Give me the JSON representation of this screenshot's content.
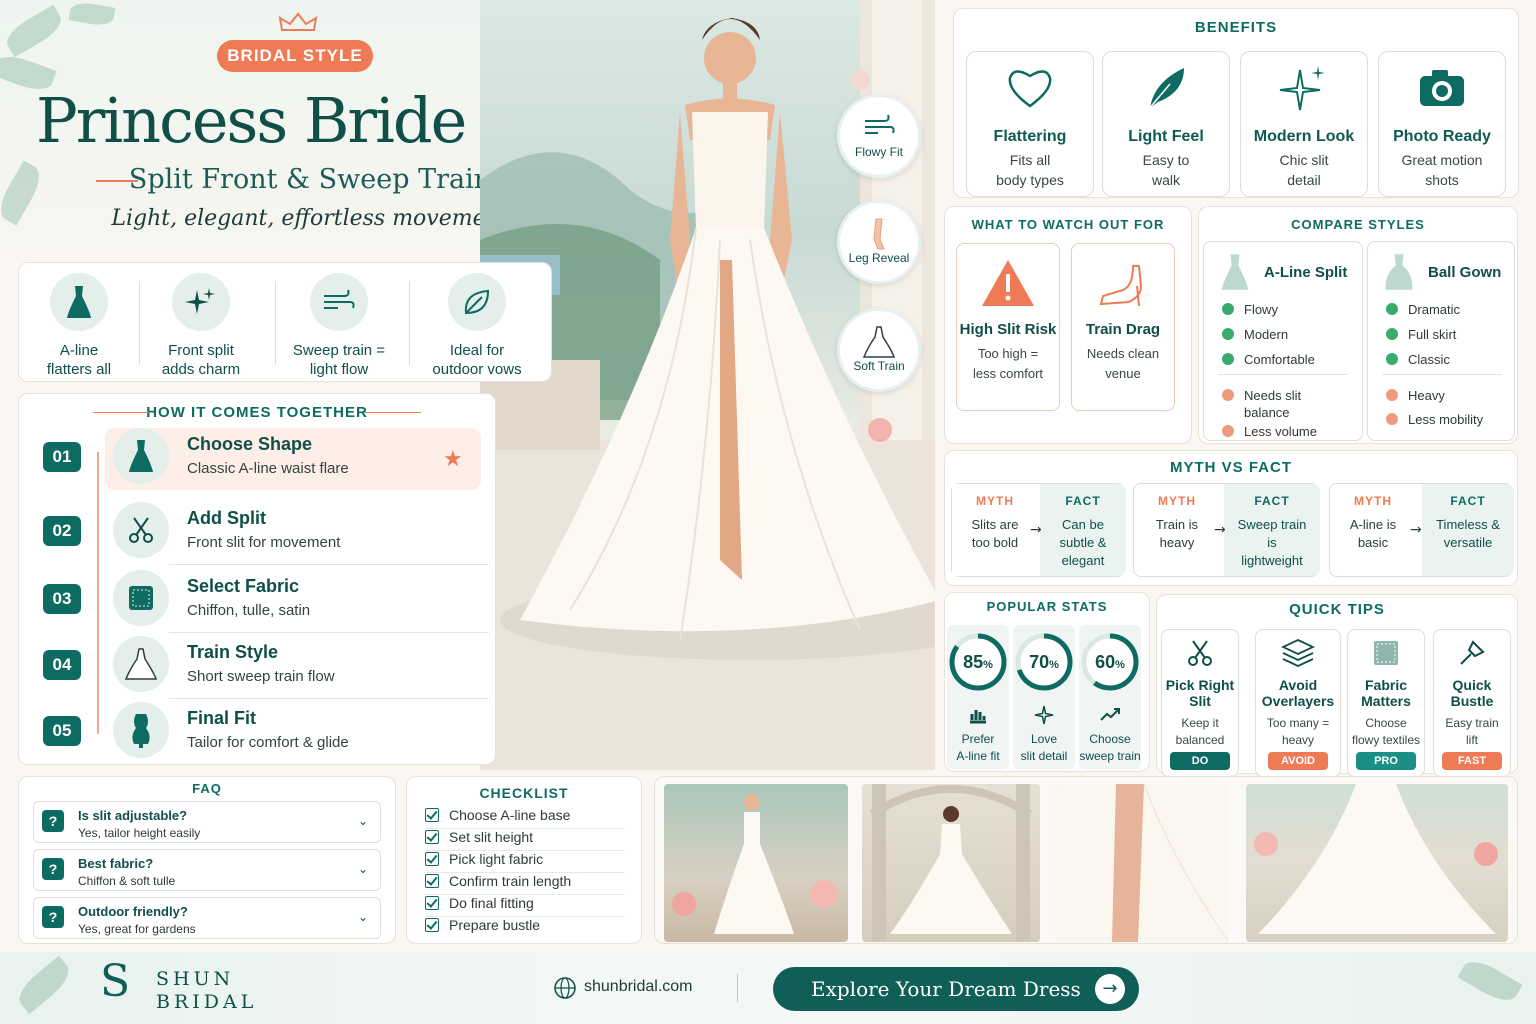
{
  "header": {
    "badge": "BRIDAL STYLE",
    "title": "Princess Bride A-Line",
    "subtitle": "Split Front & Sweep Train",
    "tagline": "Light, elegant, effortless movement"
  },
  "bubbles": [
    {
      "label": "Flowy Fit",
      "icon": "wind-icon"
    },
    {
      "label": "Leg Reveal",
      "icon": "leg-icon"
    },
    {
      "label": "Soft Train",
      "icon": "train-icon"
    }
  ],
  "features": [
    {
      "label1": "A-line",
      "label2": "flatters all",
      "icon": "dress-icon"
    },
    {
      "label1": "Front split",
      "label2": "adds charm",
      "icon": "sparkle-icon"
    },
    {
      "label1": "Sweep train =",
      "label2": "light flow",
      "icon": "wind-icon"
    },
    {
      "label1": "Ideal for",
      "label2": "outdoor vows",
      "icon": "leaf-icon"
    }
  ],
  "steps": {
    "title": "HOW IT COMES TOGETHER",
    "items": [
      {
        "num": "01",
        "title": "Choose Shape",
        "desc": "Classic A-line waist flare",
        "icon": "dress-icon"
      },
      {
        "num": "02",
        "title": "Add Split",
        "desc": "Front slit for movement",
        "icon": "scissors-icon"
      },
      {
        "num": "03",
        "title": "Select Fabric",
        "desc": "Chiffon, tulle, satin",
        "icon": "fabric-icon"
      },
      {
        "num": "04",
        "title": "Train Style",
        "desc": "Short sweep train flow",
        "icon": "train-icon"
      },
      {
        "num": "05",
        "title": "Final Fit",
        "desc": "Tailor for comfort & glide",
        "icon": "mannequin-icon"
      }
    ]
  },
  "benefits": {
    "title": "BENEFITS",
    "items": [
      {
        "title": "Flattering",
        "d1": "Fits all",
        "d2": "body types",
        "icon": "heart-icon"
      },
      {
        "title": "Light Feel",
        "d1": "Easy to",
        "d2": "walk",
        "icon": "feather-icon"
      },
      {
        "title": "Modern Look",
        "d1": "Chic slit",
        "d2": "detail",
        "icon": "sparkle-icon"
      },
      {
        "title": "Photo Ready",
        "d1": "Great motion",
        "d2": "shots",
        "icon": "camera-icon"
      }
    ]
  },
  "watch": {
    "title": "WHAT TO WATCH OUT FOR",
    "items": [
      {
        "title": "High Slit Risk",
        "d1": "Too high =",
        "d2": "less comfort",
        "icon": "warning-icon"
      },
      {
        "title": "Train Drag",
        "d1": "Needs clean",
        "d2": "venue",
        "icon": "heel-icon"
      }
    ]
  },
  "compare": {
    "title": "COMPARE STYLES",
    "a": {
      "name": "A-Line Split",
      "pros": [
        "Flowy",
        "Modern",
        "Comfortable"
      ],
      "cons": [
        "Needs slit",
        "balance",
        "Less volume"
      ]
    },
    "b": {
      "name": "Ball Gown",
      "pros": [
        "Dramatic",
        "Full skirt",
        "Classic"
      ],
      "cons": [
        "Heavy",
        "Less mobility"
      ]
    }
  },
  "myth": {
    "title": "MYTH VS FACT",
    "myth_label": "MYTH",
    "fact_label": "FACT",
    "pairs": [
      {
        "myth": [
          "Slits are",
          "too bold"
        ],
        "fact": [
          "Can be",
          "subtle &",
          "elegant"
        ]
      },
      {
        "myth": [
          "Train is",
          "heavy"
        ],
        "fact": [
          "Sweep train",
          "is",
          "lightweight"
        ]
      },
      {
        "myth": [
          "A-line is",
          "basic"
        ],
        "fact": [
          "Timeless &",
          "versatile"
        ]
      }
    ]
  },
  "stats": {
    "title": "POPULAR STATS",
    "items": [
      {
        "value": "85",
        "unit": "%",
        "pct": 85,
        "l1": "Prefer",
        "l2": "A-line fit",
        "icon": "bars-icon"
      },
      {
        "value": "70",
        "unit": "%",
        "pct": 70,
        "l1": "Love",
        "l2": "slit detail",
        "icon": "sparkle-icon"
      },
      {
        "value": "60",
        "unit": "%",
        "pct": 60,
        "l1": "Choose",
        "l2": "sweep train",
        "icon": "trend-icon"
      }
    ]
  },
  "tips": {
    "title": "QUICK TIPS",
    "items": [
      {
        "t1": "Pick Right",
        "t2": "Slit",
        "d1": "Keep it",
        "d2": "balanced",
        "badge": "DO",
        "color": "#0e6b62",
        "icon": "scissors-icon"
      },
      {
        "t1": "Avoid",
        "t2": "Overlayers",
        "d1": "Too many =",
        "d2": "heavy",
        "badge": "AVOID",
        "color": "#ef7a56",
        "icon": "layers-icon"
      },
      {
        "t1": "Fabric",
        "t2": "Matters",
        "d1": "Choose",
        "d2": "flowy textiles",
        "badge": "PRO",
        "color": "#1b8f86",
        "icon": "fabric-icon"
      },
      {
        "t1": "Quick",
        "t2": "Bustle",
        "d1": "Easy train",
        "d2": "lift",
        "badge": "FAST",
        "color": "#ef7a56",
        "icon": "pin-icon"
      }
    ]
  },
  "faq": {
    "title": "FAQ",
    "items": [
      {
        "q": "Is slit adjustable?",
        "a": "Yes, tailor height easily"
      },
      {
        "q": "Best fabric?",
        "a": "Chiffon & soft tulle"
      },
      {
        "q": "Outdoor friendly?",
        "a": "Yes, great for gardens"
      }
    ]
  },
  "checklist": {
    "title": "CHECKLIST",
    "items": [
      "Choose A-line base",
      "Set slit height",
      "Pick light fabric",
      "Confirm train length",
      "Do final fitting",
      "Prepare bustle"
    ]
  },
  "footer": {
    "brand1": "SHUN",
    "brand2": "BRIDAL",
    "monogram": "S",
    "website": "shunbridal.com",
    "cta": "Explore Your Dream Dress",
    "cta_arrow": "→"
  },
  "colors": {
    "teal": "#0e6b62",
    "coral": "#ef7a56",
    "cream": "#faf7f3"
  }
}
